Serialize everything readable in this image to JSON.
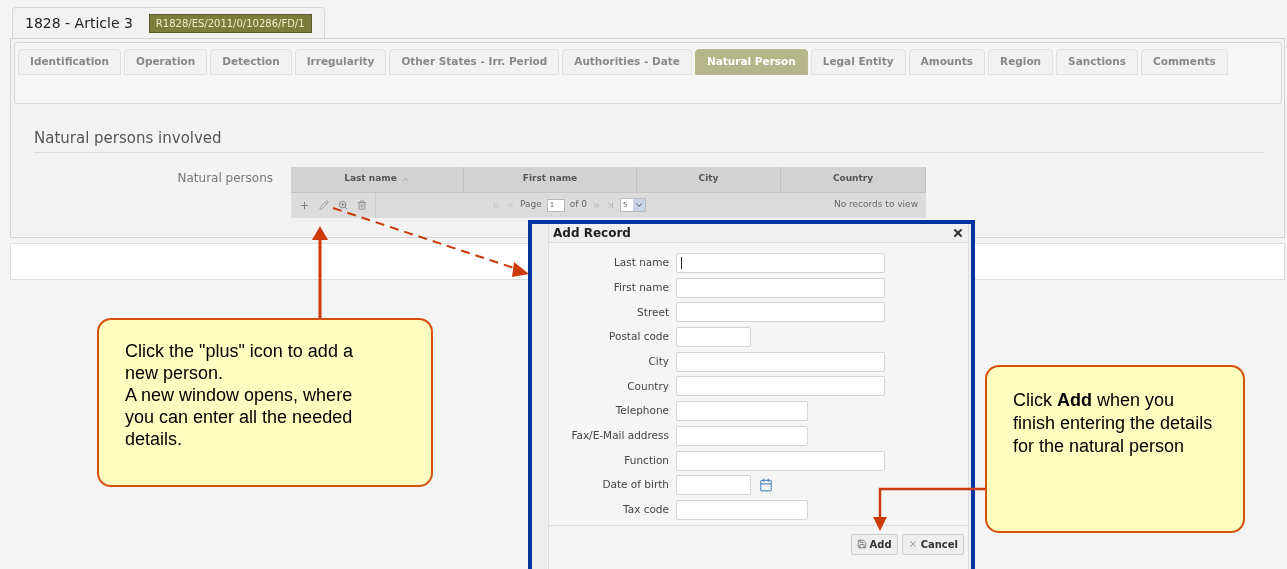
{
  "record_tab": {
    "title": "1828 - Article 3",
    "reference": "R1828/ES/2011/0/10286/FD/1"
  },
  "tabs": [
    {
      "label": "Identification",
      "selected": false
    },
    {
      "label": "Operation",
      "selected": false
    },
    {
      "label": "Detection",
      "selected": false
    },
    {
      "label": "Irregularity",
      "selected": false
    },
    {
      "label": "Other States - Irr. Period",
      "selected": false
    },
    {
      "label": "Authorities - Date",
      "selected": false
    },
    {
      "label": "Natural Person",
      "selected": true
    },
    {
      "label": "Legal Entity",
      "selected": false
    },
    {
      "label": "Amounts",
      "selected": false
    },
    {
      "label": "Region",
      "selected": false
    },
    {
      "label": "Sanctions",
      "selected": false
    },
    {
      "label": "Comments",
      "selected": false
    }
  ],
  "section": {
    "title": "Natural persons involved",
    "field_label": "Natural persons"
  },
  "grid": {
    "columns": [
      {
        "label": "Last name",
        "sorted": true
      },
      {
        "label": "First name",
        "sorted": false
      },
      {
        "label": "City",
        "sorted": false
      },
      {
        "label": "Country",
        "sorted": false
      }
    ],
    "pager": {
      "page_label": "Page",
      "page_value": "1",
      "of_label": "of 0",
      "page_size": "5",
      "status": "No records to view"
    }
  },
  "dialog": {
    "title": "Add Record",
    "fields": [
      {
        "label": "Last name",
        "kind": "long",
        "focused": true
      },
      {
        "label": "First name",
        "kind": "long",
        "focused": false
      },
      {
        "label": "Street",
        "kind": "long",
        "focused": false
      },
      {
        "label": "Postal code",
        "kind": "short",
        "focused": false
      },
      {
        "label": "City",
        "kind": "long",
        "focused": false
      },
      {
        "label": "Country",
        "kind": "long",
        "focused": false
      },
      {
        "label": "Telephone",
        "kind": "medium",
        "focused": false
      },
      {
        "label": "Fax/E-Mail address",
        "kind": "medium",
        "focused": false
      },
      {
        "label": "Function",
        "kind": "long",
        "focused": false
      },
      {
        "label": "Date of birth",
        "kind": "date",
        "focused": false
      },
      {
        "label": "Tax code",
        "kind": "medium",
        "focused": false
      }
    ],
    "buttons": [
      {
        "label": "Add",
        "kind": "save"
      },
      {
        "label": "Cancel",
        "kind": "cancel"
      }
    ]
  },
  "callouts": [
    {
      "kind": "left",
      "paragraphs": [
        "Click the \"plus\" icon to add a new person.",
        "A new window opens, where you can enter all the needed details."
      ]
    },
    {
      "kind": "right",
      "paragraphs": [
        "Click **Add** when you finish entering the details for the natural person"
      ]
    }
  ]
}
